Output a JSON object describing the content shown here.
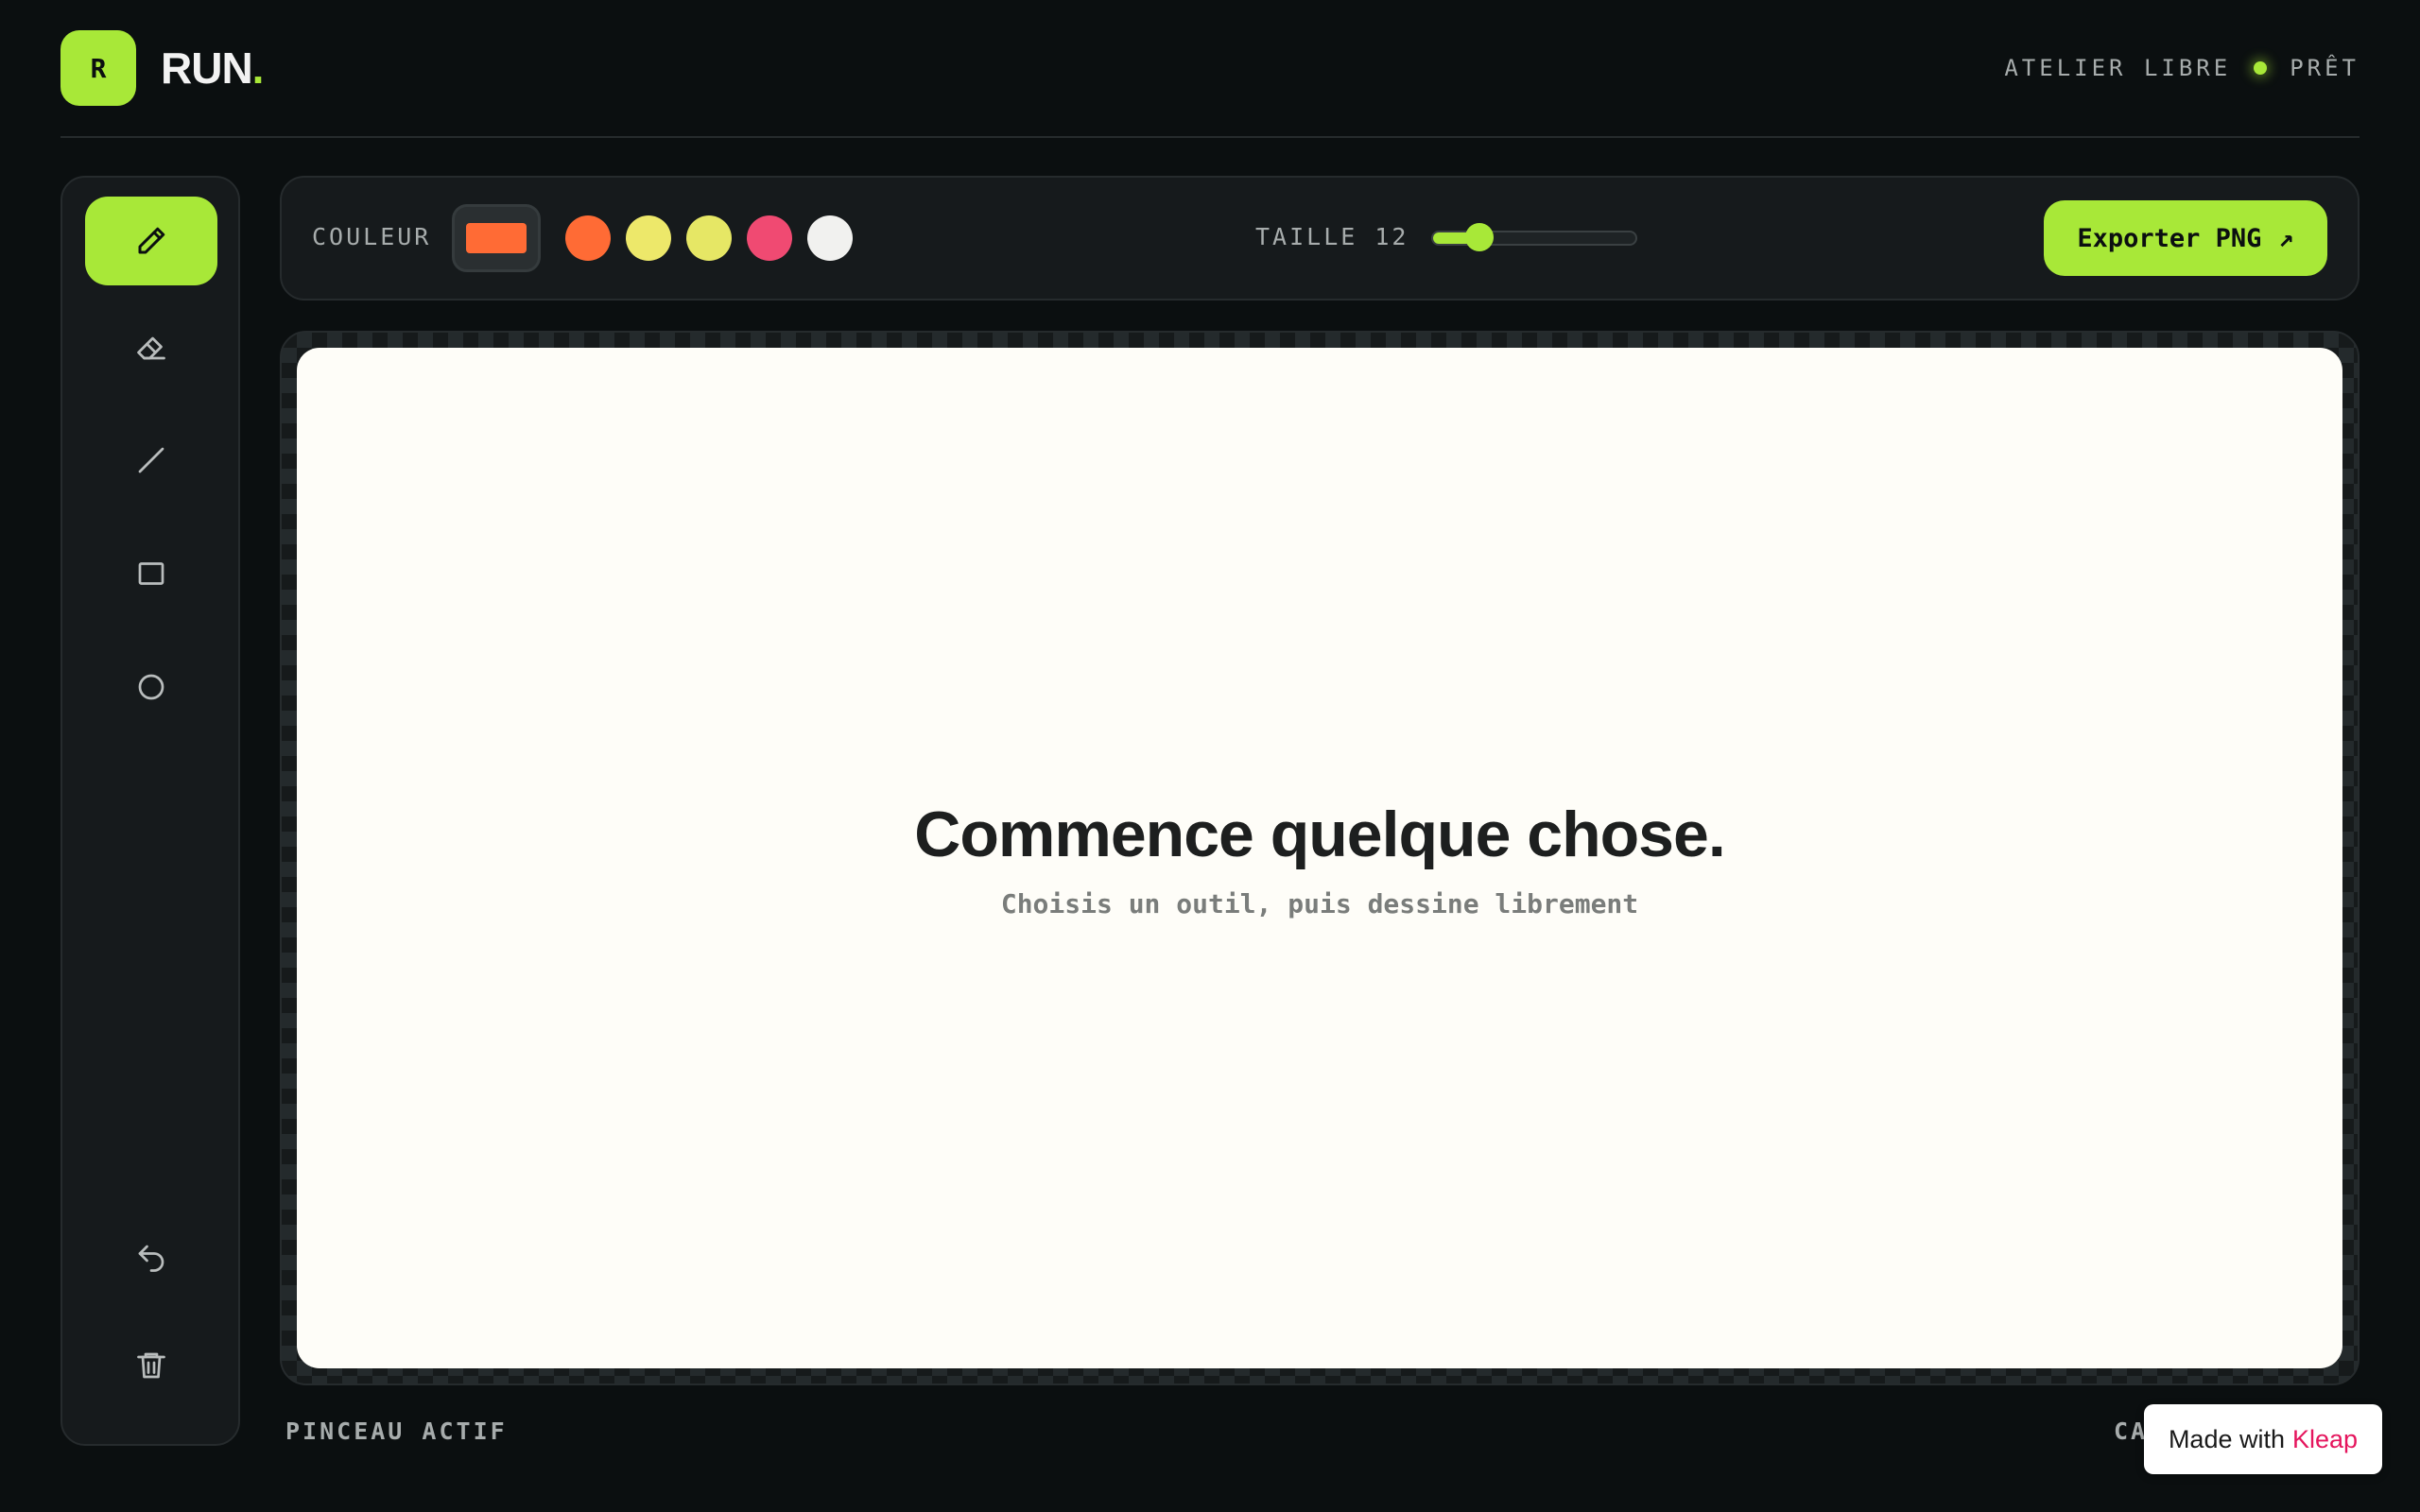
{
  "header": {
    "logo_letter": "R",
    "brand_name": "RUN",
    "brand_dot": ".",
    "workspace": "ATELIER LIBRE",
    "status": "PRÊT"
  },
  "colors": {
    "accent": "#a8e838",
    "background": "#0b0f10",
    "canvas": "#fefdf8"
  },
  "sidebar": {
    "tools": [
      {
        "name": "pencil",
        "icon": "pencil-icon",
        "active": true
      },
      {
        "name": "eraser",
        "icon": "eraser-icon",
        "active": false
      },
      {
        "name": "line",
        "icon": "line-icon",
        "active": false
      },
      {
        "name": "rectangle",
        "icon": "rectangle-icon",
        "active": false
      },
      {
        "name": "circle",
        "icon": "circle-icon",
        "active": false
      }
    ],
    "actions": [
      {
        "name": "undo",
        "icon": "undo-icon"
      },
      {
        "name": "clear",
        "icon": "trash-icon"
      }
    ]
  },
  "toolbar": {
    "color_label": "COULEUR",
    "current_color": "#ff6b35",
    "palette": [
      "#ff6b35",
      "#ede86a",
      "#e6e765",
      "#f04a72",
      "#f1f1ef"
    ],
    "size_label": "TAILLE",
    "size_value": "12",
    "size_fraction": 0.23,
    "export_label": "Exporter PNG",
    "export_icon": "↗"
  },
  "canvas": {
    "title": "Commence quelque chose.",
    "subtitle": "Choisis un outil, puis dessine librement"
  },
  "footer": {
    "active_tool": "PINCEAU ACTIF",
    "right_text": "CA"
  },
  "badge": {
    "prefix": "Made with",
    "brand": "Kleap"
  }
}
